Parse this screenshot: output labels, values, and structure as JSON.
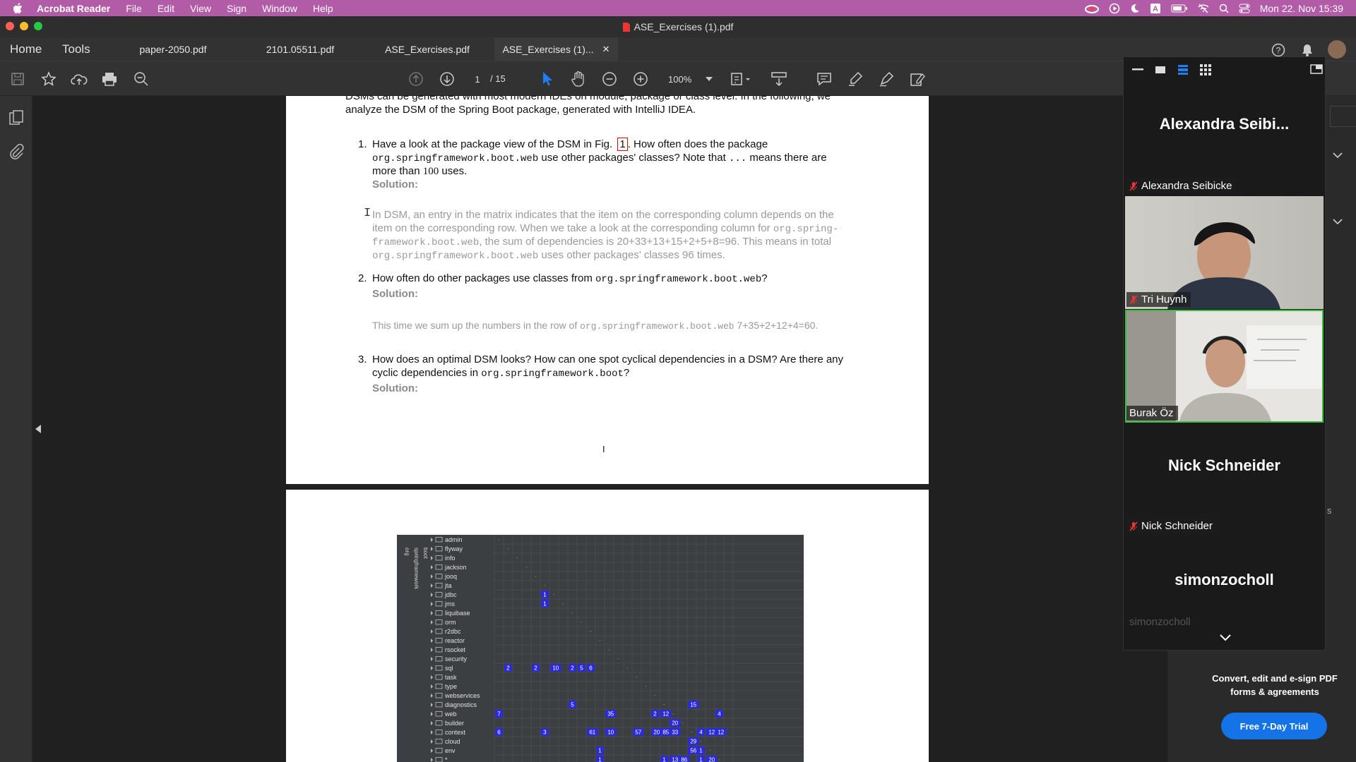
{
  "menubar": {
    "app": "Acrobat Reader",
    "items": [
      "File",
      "Edit",
      "View",
      "Sign",
      "Window",
      "Help"
    ],
    "clock": "Mon 22. Nov  15:39"
  },
  "window": {
    "title": "ASE_Exercises (1).pdf"
  },
  "nav": {
    "home": "Home",
    "tools": "Tools"
  },
  "tabs": [
    "paper-2050.pdf",
    "2101.05511.pdf",
    "ASE_Exercises.pdf",
    "ASE_Exercises (1)..."
  ],
  "toolbar": {
    "page_current": "1",
    "page_total": "/ 15",
    "zoom": "100%"
  },
  "doc": {
    "intro1": "DSMs can be generated with most modern IDEs on module, package or class level.  In the following, we",
    "intro2": "analyze the DSM of the Spring Boot package, generated with IntelliJ IDEA.",
    "q1_num": "1.",
    "q1_a": "Have a look at the package view of the DSM in Fig.",
    "q1_ref": "1",
    "q1_b": ". How often does the package",
    "q1_code": "org.springframework.boot.web",
    "q1_c": " use other packages' classes? Note that ",
    "q1_dots": "...",
    "q1_d": " means there are",
    "q1_e": "more than ",
    "q1_100": "100",
    "q1_f": " uses.",
    "solution": "Solution:",
    "s1_l1": "In DSM, an entry in the matrix indicates that the item on the corresponding column depends on the",
    "s1_l2a": "item on the corresponding row. When we take a look at the corresponding column for ",
    "s1_l2code": "org.spring-",
    "s1_l3code": "framework.boot.web",
    "s1_l3b": ", the sum of dependencies is 20+33+13+15+2+5+8=96.  This means in total",
    "s1_l4code": "org.springframework.boot.web",
    "s1_l4b": " uses other packages' classes 96 times.",
    "q2_num": "2.",
    "q2_a": "How often do other packages use classes from ",
    "q2_code": "org.springframework.boot.web",
    "q2_b": "?",
    "s2_a": "This time we sum up the numbers in the row of ",
    "s2_code": "org.springframework.boot.web",
    "s2_b": " 7+35+2+12+4=60.",
    "q3_num": "3.",
    "q3_l1": "How does an optimal DSM looks? How can one spot cyclical dependencies in a DSM? Are there any",
    "q3_l2a": "cyclic dependencies in ",
    "q3_code": "org.springframework.boot",
    "q3_l2b": "?",
    "page_num": "I"
  },
  "dsm": {
    "header_cols": [
      "org",
      "springframework",
      "boot"
    ],
    "rows": [
      "admin",
      "flyway",
      "info",
      "jackson",
      "jooq",
      "jta",
      "jdbc",
      "jms",
      "liquibase",
      "orm",
      "r2dbc",
      "reactor",
      "rsocket",
      "security",
      "sql",
      "task",
      "type",
      "webservices",
      "diagnostics",
      "web",
      "builder",
      "context",
      "cloud",
      "env",
      "*"
    ],
    "cells": [
      {
        "r": 6,
        "c": 5,
        "v": "1"
      },
      {
        "r": 7,
        "c": 5,
        "v": "1"
      },
      {
        "r": 14,
        "c": 1,
        "v": "2"
      },
      {
        "r": 14,
        "c": 4,
        "v": "2"
      },
      {
        "r": 14,
        "c": 6,
        "v": "10"
      },
      {
        "r": 14,
        "c": 8,
        "v": "2"
      },
      {
        "r": 14,
        "c": 9,
        "v": "5"
      },
      {
        "r": 14,
        "c": 10,
        "v": "6"
      },
      {
        "r": 18,
        "c": 8,
        "v": "5"
      },
      {
        "r": 18,
        "c": 21,
        "v": "15"
      },
      {
        "r": 19,
        "c": 0,
        "v": "7"
      },
      {
        "r": 19,
        "c": 12,
        "v": "35"
      },
      {
        "r": 19,
        "c": 17,
        "v": "2"
      },
      {
        "r": 19,
        "c": 18,
        "v": "12"
      },
      {
        "r": 19,
        "c": 24,
        "v": "4"
      },
      {
        "r": 20,
        "c": 19,
        "v": "20"
      },
      {
        "r": 21,
        "c": 0,
        "v": "6"
      },
      {
        "r": 21,
        "c": 5,
        "v": "3"
      },
      {
        "r": 21,
        "c": 10,
        "v": "61"
      },
      {
        "r": 21,
        "c": 12,
        "v": "10"
      },
      {
        "r": 21,
        "c": 15,
        "v": "57"
      },
      {
        "r": 21,
        "c": 17,
        "v": "20"
      },
      {
        "r": 21,
        "c": 18,
        "v": "85"
      },
      {
        "r": 21,
        "c": 19,
        "v": "33"
      },
      {
        "r": 21,
        "c": 22,
        "v": "4"
      },
      {
        "r": 21,
        "c": 23,
        "v": "12"
      },
      {
        "r": 21,
        "c": 24,
        "v": "12"
      },
      {
        "r": 22,
        "c": 21,
        "v": "29"
      },
      {
        "r": 23,
        "c": 11,
        "v": "1"
      },
      {
        "r": 23,
        "c": 21,
        "v": "56"
      },
      {
        "r": 23,
        "c": 22,
        "v": "1"
      },
      {
        "r": 24,
        "c": 11,
        "v": "1"
      },
      {
        "r": 24,
        "c": 18,
        "v": "1"
      },
      {
        "r": 24,
        "c": 19,
        "v": "13"
      },
      {
        "r": 24,
        "c": 20,
        "v": "86"
      },
      {
        "r": 24,
        "c": 22,
        "v": "1"
      },
      {
        "r": 24,
        "c": 23,
        "v": "20"
      }
    ]
  },
  "participants": [
    {
      "tile_name": "Alexandra  Seibi...",
      "label": "Alexandra Seibicke",
      "muted": true
    },
    {
      "label": "Tri Huynh",
      "muted": true
    },
    {
      "label": "Burak Öz",
      "muted": false
    },
    {
      "tile_name": "Nick Schneider",
      "label": "Nick Schneider",
      "muted": true
    },
    {
      "tile_name": "simonzocholl",
      "label": "simonzocholl"
    }
  ],
  "panel_hint": "s",
  "promo": {
    "line1": "Convert, edit and e-sign PDF",
    "line2": "forms & agreements",
    "button": "Free 7-Day Trial"
  }
}
